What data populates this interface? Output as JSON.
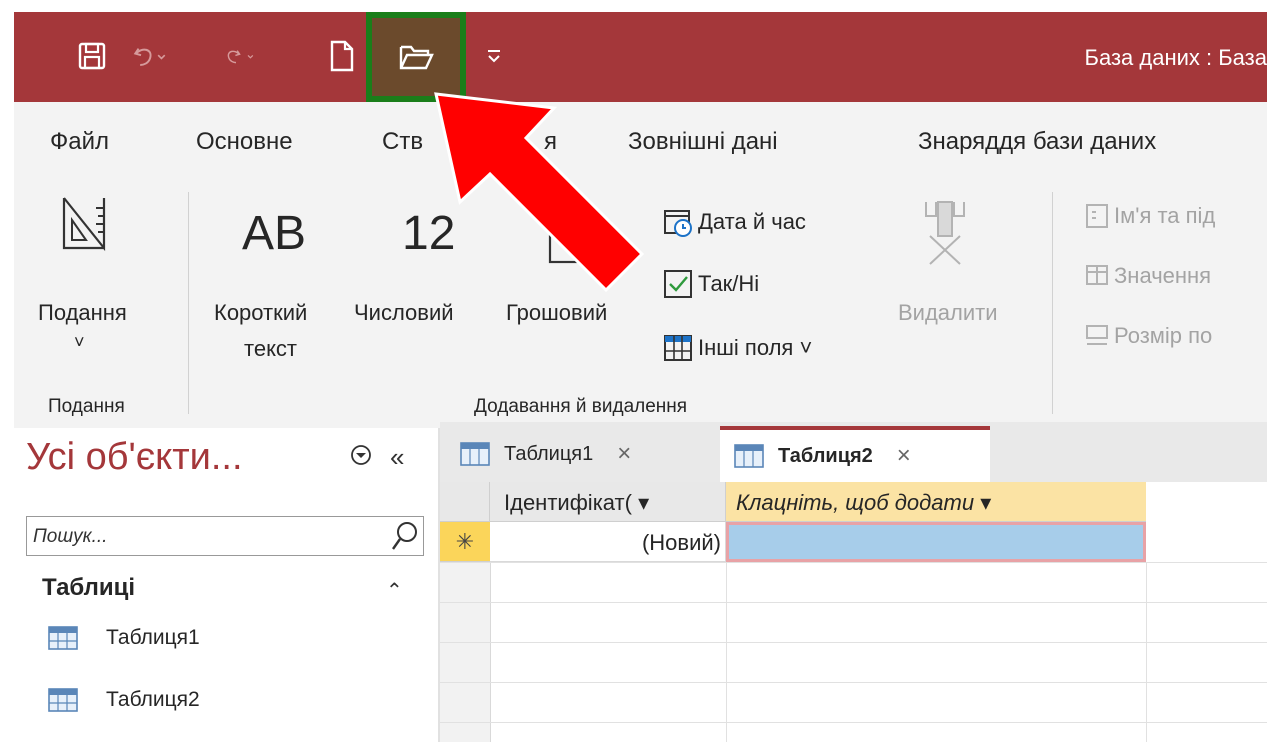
{
  "window": {
    "title": "База даних : База"
  },
  "quick_access": {
    "icons": [
      "save-icon",
      "undo-icon",
      "redo-icon",
      "new-icon",
      "open-icon",
      "customize-icon"
    ]
  },
  "ribbon_tabs": [
    "Файл",
    "Основне",
    "Ств",
    "я",
    "Зовнішні дані",
    "Знаряддя бази даних"
  ],
  "ribbon": {
    "view_group": {
      "button_label": "Подання",
      "title": "Подання"
    },
    "add_delete_group": {
      "short_text_big": "AB",
      "short_text_label1": "Короткий",
      "short_text_label2": "текст",
      "number_big": "12",
      "number_label": "Числовий",
      "currency_label": "Грошовий",
      "date_time": "Дата й час",
      "yes_no": "Так/Ні",
      "more_fields": "Інші поля ˅",
      "delete": "Видалити",
      "title": "Додавання й видалення"
    },
    "properties_group": {
      "name_caption": "Ім'я та під",
      "default_value": "Значення",
      "field_size": "Розмір по"
    }
  },
  "nav_pane": {
    "header": "Усі об'єкти...",
    "collapse": "«",
    "search_placeholder": "Пошук...",
    "section": "Таблиці",
    "items": [
      "Таблиця1",
      "Таблиця2"
    ]
  },
  "doc_tabs": [
    {
      "label": "Таблиця1",
      "close": "×"
    },
    {
      "label": "Таблиця2",
      "close": "×"
    }
  ],
  "datasheet": {
    "col_id": "Ідентифікат( ▾",
    "col_add": "Клацніть, щоб додати  ▾",
    "new_row_marker": "✳",
    "new_row_value": "(Новий)"
  },
  "colors": {
    "accent": "#a4373a",
    "highlight_border": "#1a7e1a",
    "arrow": "#ff0000"
  }
}
